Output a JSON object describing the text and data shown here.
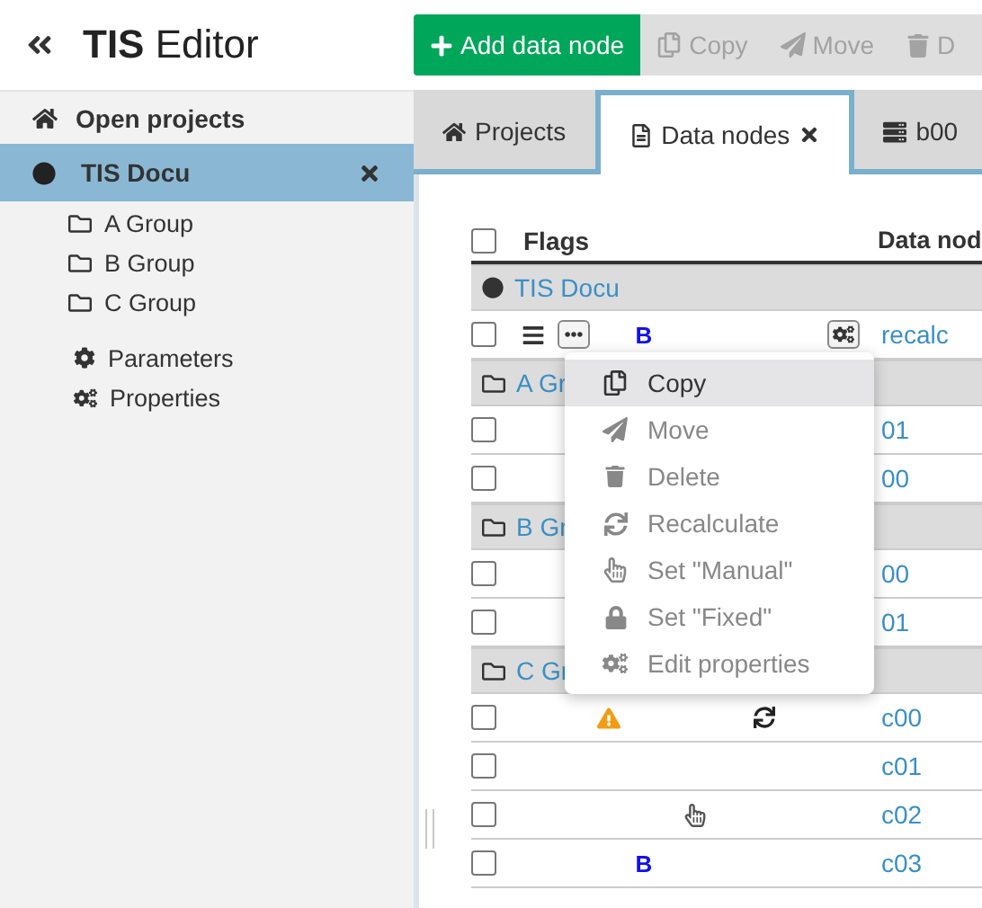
{
  "title": "**TIS** Editor",
  "toolbar": [
    {
      "label": "Add data node",
      "kind": "add"
    },
    {
      "label": "Copy",
      "kind": "copy"
    },
    {
      "label": "Move",
      "kind": "move"
    },
    {
      "label": "D",
      "kind": "delete"
    }
  ],
  "sidebar": {
    "header": "Open projects",
    "project": {
      "name": "TIS Docu",
      "selected": true
    },
    "groups": [
      "A Group",
      "B Group",
      "C Group"
    ],
    "settings": [
      {
        "label": "Parameters",
        "kind": "parameters"
      },
      {
        "label": "Properties",
        "kind": "properties"
      }
    ]
  },
  "tabs": [
    {
      "label": "Projects",
      "kind": "projects",
      "selected": false,
      "closable": false
    },
    {
      "label": "Data nodes",
      "kind": "data",
      "selected": true,
      "closable": true
    },
    {
      "label": "b00",
      "kind": "node",
      "selected": false,
      "closable": false
    }
  ],
  "table": {
    "columns": [
      "Flags",
      "Data nod"
    ],
    "header_checked": false,
    "rows": [
      {
        "kind": "project",
        "label": "TIS Docu"
      },
      {
        "kind": "node",
        "checked": false,
        "flags": [
          {
            "kind": "menu"
          },
          {
            "kind": "more"
          },
          {
            "kind": "bold",
            "text": "B"
          },
          {
            "kind": "properties"
          }
        ],
        "name": "recalc"
      },
      {
        "kind": "group",
        "label": "A Gr"
      },
      {
        "kind": "node",
        "checked": false,
        "flags": [],
        "name": "01"
      },
      {
        "kind": "node",
        "checked": false,
        "flags": [],
        "name": "00"
      },
      {
        "kind": "group",
        "label": "B Gr"
      },
      {
        "kind": "node",
        "checked": false,
        "flags": [],
        "name": "00"
      },
      {
        "kind": "node",
        "checked": false,
        "flags": [],
        "name": "01"
      },
      {
        "kind": "group",
        "label": "C Gr"
      },
      {
        "kind": "node",
        "checked": false,
        "flags": [
          {
            "kind": "warning"
          },
          {
            "kind": "recalc"
          }
        ],
        "name": "c00"
      },
      {
        "kind": "node",
        "checked": false,
        "flags": [],
        "name": "c01"
      },
      {
        "kind": "node",
        "checked": false,
        "flags": [
          {
            "kind": "manual"
          }
        ],
        "name": "c02"
      },
      {
        "kind": "node",
        "checked": false,
        "flags": [
          {
            "kind": "bold",
            "text": "B"
          }
        ],
        "name": "c03"
      }
    ]
  },
  "menu": [
    {
      "label": "Copy",
      "kind": "copy",
      "selected": true
    },
    {
      "label": "Move",
      "kind": "move",
      "selected": false
    },
    {
      "label": "Delete",
      "kind": "delete",
      "selected": false
    },
    {
      "label": "Recalculate",
      "kind": "recalc",
      "selected": false
    },
    {
      "label": "Set \"Manual\"",
      "kind": "manual",
      "selected": false
    },
    {
      "label": "Set \"Fixed\"",
      "kind": "fixed",
      "selected": false
    },
    {
      "label": "Edit properties",
      "kind": "properties",
      "selected": false
    }
  ]
}
